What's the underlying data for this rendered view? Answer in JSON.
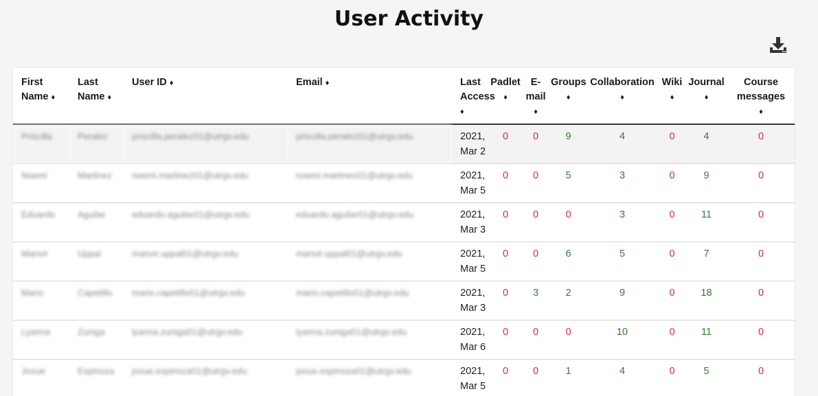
{
  "page": {
    "title": "User Activity"
  },
  "toolbar": {
    "download_icon": "download-icon"
  },
  "table": {
    "headers": [
      {
        "l1": "First",
        "l2": "Name",
        "sort": "♦"
      },
      {
        "l1": "Last",
        "l2": "Name",
        "sort": "♦"
      },
      {
        "l1": "User ID",
        "l2": "",
        "sort": "♦"
      },
      {
        "l1": "Email",
        "l2": "",
        "sort": "♦"
      },
      {
        "l1": "Last",
        "l2": "Access",
        "sort": "♦"
      },
      {
        "l1": "Padlet",
        "l2": "",
        "sort": "♦"
      },
      {
        "l1": "E-",
        "l2": "mail",
        "sort": "♦"
      },
      {
        "l1": "Groups",
        "l2": "",
        "sort": "♦"
      },
      {
        "l1": "Collaboration",
        "l2": "",
        "sort": "♦"
      },
      {
        "l1": "Wiki",
        "l2": "",
        "sort": "♦"
      },
      {
        "l1": "Journal",
        "l2": "",
        "sort": "♦"
      },
      {
        "l1": "Course",
        "l2": "messages",
        "sort": "♦"
      }
    ],
    "rows": [
      {
        "first": "Priscilla",
        "last": "Peralez",
        "user_id": "priscilla.peralez01@utrgv.edu",
        "email": "priscilla.peralez01@utrgv.edu",
        "access_year": "2021,",
        "access_date": "Mar 2",
        "padlet": "0",
        "email_count": "0",
        "groups": "9",
        "collaboration": "4",
        "wiki": "0",
        "journal": "4",
        "course_messages": "0"
      },
      {
        "first": "Noemi",
        "last": "Martinez",
        "user_id": "noemi.martinez01@utrgv.edu",
        "email": "noemi.martinez01@utrgv.edu",
        "access_year": "2021,",
        "access_date": "Mar 5",
        "padlet": "0",
        "email_count": "0",
        "groups": "5",
        "collaboration": "3",
        "wiki": "0",
        "journal": "9",
        "course_messages": "0"
      },
      {
        "first": "Eduardo",
        "last": "Aguilar",
        "user_id": "eduardo.aguilar01@utrgv.edu",
        "email": "eduardo.aguilar01@utrgv.edu",
        "access_year": "2021,",
        "access_date": "Mar 3",
        "padlet": "0",
        "email_count": "0",
        "groups": "0",
        "collaboration": "3",
        "wiki": "0",
        "journal": "11",
        "course_messages": "0"
      },
      {
        "first": "Manvir",
        "last": "Uppal",
        "user_id": "manvir.uppal01@utrgv.edu",
        "email": "manvir.uppal01@utrgv.edu",
        "access_year": "2021,",
        "access_date": "Mar 5",
        "padlet": "0",
        "email_count": "0",
        "groups": "6",
        "collaboration": "5",
        "wiki": "0",
        "journal": "7",
        "course_messages": "0"
      },
      {
        "first": "Mario",
        "last": "Capetillo",
        "user_id": "mario.capetillo01@utrgv.edu",
        "email": "mario.capetillo01@utrgv.edu",
        "access_year": "2021,",
        "access_date": "Mar 3",
        "padlet": "0",
        "email_count": "3",
        "groups": "2",
        "collaboration": "9",
        "wiki": "0",
        "journal": "18",
        "course_messages": "0"
      },
      {
        "first": "Lyanna",
        "last": "Zuniga",
        "user_id": "lyanna.zuniga01@utrgv.edu",
        "email": "lyanna.zuniga01@utrgv.edu",
        "access_year": "2021,",
        "access_date": "Mar 6",
        "padlet": "0",
        "email_count": "0",
        "groups": "0",
        "collaboration": "10",
        "wiki": "0",
        "journal": "11",
        "course_messages": "0"
      },
      {
        "first": "Josue",
        "last": "Espinoza",
        "user_id": "josue.espinoza01@utrgv.edu",
        "email": "josue.espinoza01@utrgv.edu",
        "access_year": "2021,",
        "access_date": "Mar 5",
        "padlet": "0",
        "email_count": "0",
        "groups": "1",
        "collaboration": "4",
        "wiki": "0",
        "journal": "5",
        "course_messages": "0"
      }
    ]
  },
  "colors": {
    "zero": "#d32f2f",
    "positive": "#2e7d32",
    "header_rule": "#333333"
  }
}
